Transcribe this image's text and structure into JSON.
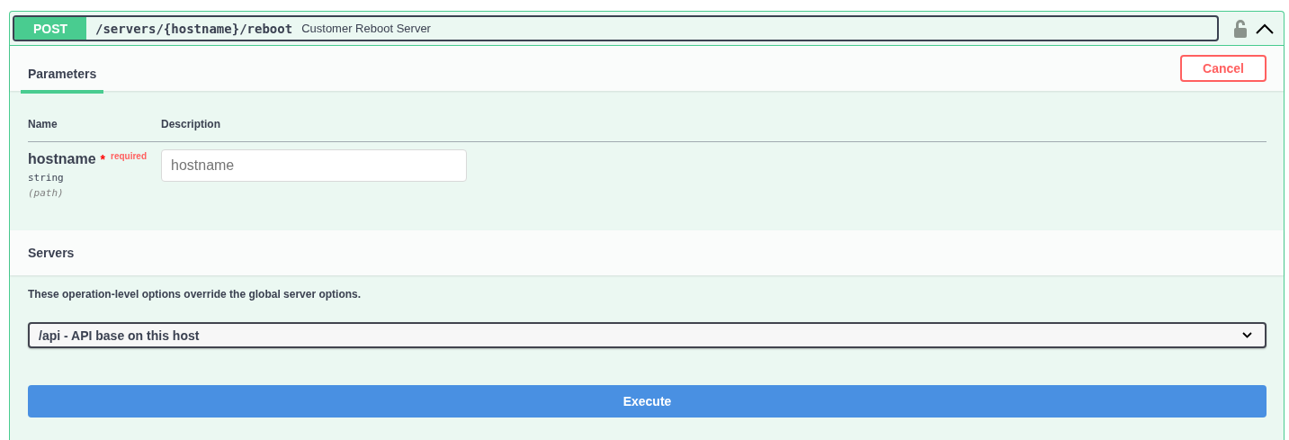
{
  "operation": {
    "method": "POST",
    "path": "/servers/{hostname}/reboot",
    "summary": "Customer Reboot Server",
    "expanded": true
  },
  "tabs": [
    {
      "label": "Parameters",
      "selected": true
    }
  ],
  "cancel_button": "Cancel",
  "parameters": {
    "columns": [
      "Name",
      "Description"
    ],
    "rows": [
      {
        "name": "hostname",
        "required_star": "*",
        "required_label": "required",
        "type": "string",
        "location": "(path)",
        "placeholder": "hostname"
      }
    ]
  },
  "servers": {
    "title": "Servers",
    "description": "These operation-level options override the global server options.",
    "selected_server": "/api - API base on this host"
  },
  "execute_button": "Execute"
}
